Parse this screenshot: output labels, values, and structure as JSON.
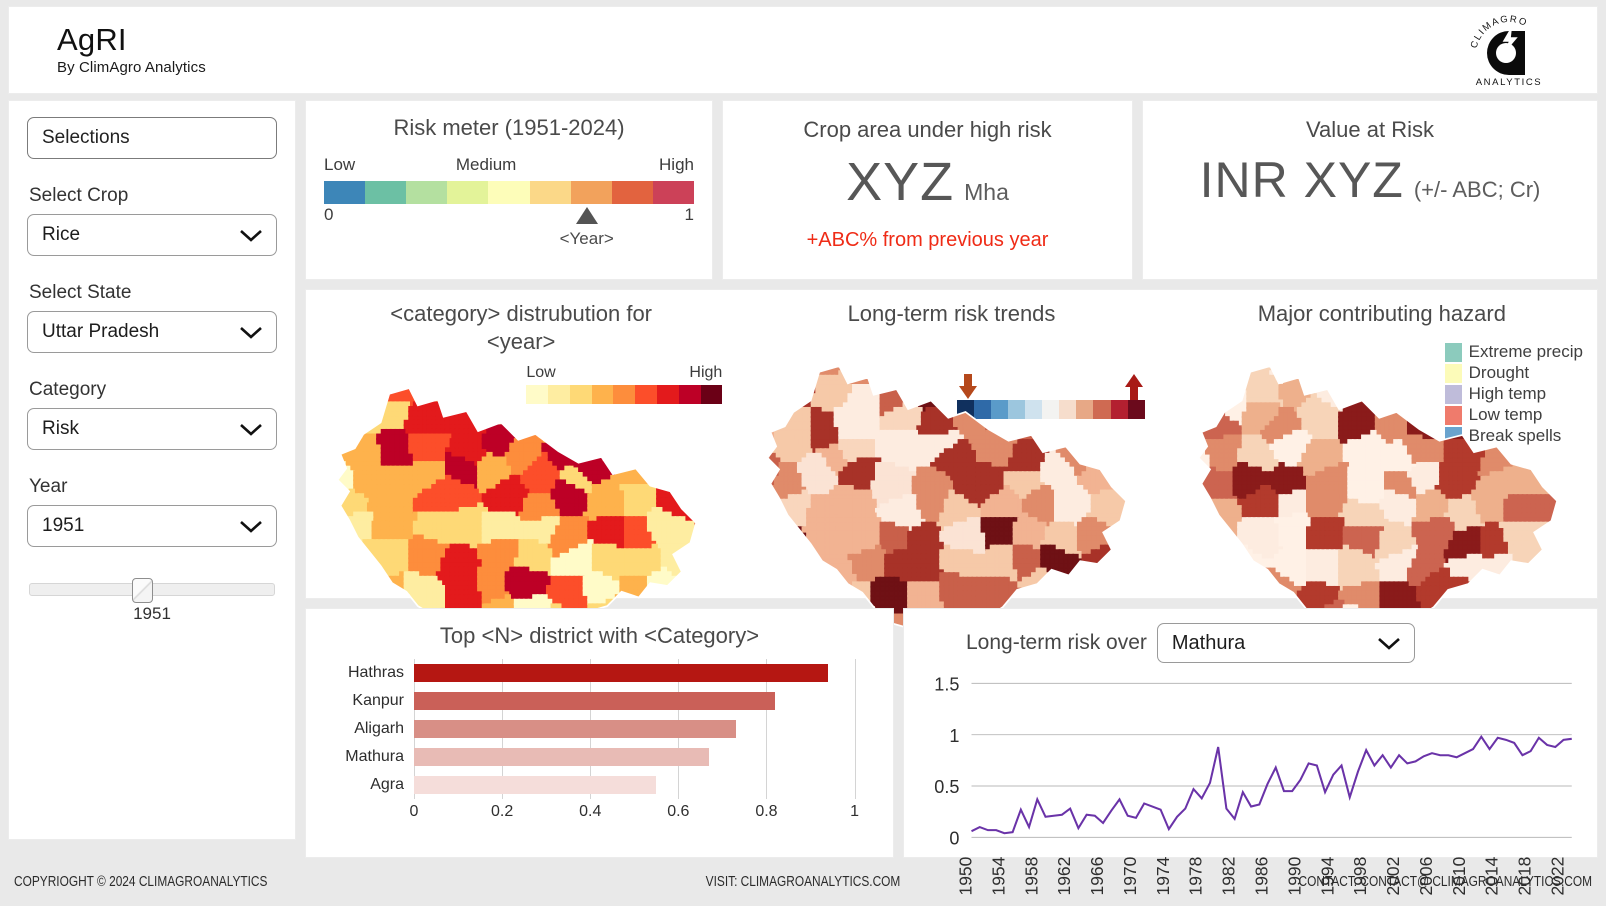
{
  "header": {
    "title": "AgRI",
    "subtitle": "By ClimAgro Analytics",
    "logo_top": "CLIMAGRO",
    "logo_bottom": "ANALYTICS"
  },
  "sidebar": {
    "panel_label": "Selections",
    "fields": [
      {
        "label": "Select Crop",
        "value": "Rice"
      },
      {
        "label": "Select State",
        "value": "Uttar Pradesh"
      },
      {
        "label": "Category",
        "value": "Risk"
      },
      {
        "label": "Year",
        "value": "1951"
      }
    ],
    "slider": {
      "value": "1951",
      "position_pct": 42
    }
  },
  "kpi": {
    "meter": {
      "title": "Risk meter (1951-2024)",
      "label_low": "Low",
      "label_medium": "Medium",
      "label_high": "High",
      "min": "0",
      "max": "1",
      "pointer_label": "<Year>",
      "pointer_pct": 71,
      "colors": [
        "#3d86b8",
        "#6cc0a4",
        "#b4e0a0",
        "#e3f399",
        "#fdfdb9",
        "#fbd888",
        "#f2a25c",
        "#e2633f",
        "#cc4158"
      ]
    },
    "crop_area": {
      "title": "Crop area under high risk",
      "value": "XYZ",
      "unit": "Mha",
      "delta": "+ABC% from previous year",
      "delta_color": "#ef2b16"
    },
    "value_at_risk": {
      "title": "Value at Risk",
      "value": "INR XYZ",
      "unit": "(+/- ABC; Cr)"
    }
  },
  "maps": {
    "distribution": {
      "title_line1": "<category> distrubution for",
      "title_line2": "<year>",
      "cbar_low": "Low",
      "cbar_high": "High",
      "colors": [
        "#fffbc8",
        "#feeda1",
        "#fed976",
        "#feb24c",
        "#fd8d3c",
        "#fc4e2a",
        "#e31a1c",
        "#bd0026",
        "#6b0016"
      ]
    },
    "trends": {
      "title": "Long-term risk trends",
      "colors": [
        "#10305e",
        "#2f6aa8",
        "#5a9bc9",
        "#9cc6de",
        "#cfe2ee",
        "#f3f3f1",
        "#f6ddcc",
        "#e7a886",
        "#cf6a52",
        "#b32030",
        "#6b0a1c"
      ],
      "down_arrow_color": "#b5481b",
      "up_arrow_color": "#a81a16"
    },
    "hazard": {
      "title": "Major contributing hazard",
      "legend": [
        {
          "label": "Extreme precip",
          "color": "#8ccbbd"
        },
        {
          "label": "Drought",
          "color": "#fcfbb9"
        },
        {
          "label": "High temp",
          "color": "#bfbcda"
        },
        {
          "label": "Low temp",
          "color": "#ef7b6c"
        },
        {
          "label": "Break spells",
          "color": "#6aa3ce"
        }
      ]
    }
  },
  "bar_panel": {
    "title": "Top <N> district with <Category>"
  },
  "line_panel": {
    "label": "Long-term risk over",
    "district": "Mathura"
  },
  "footer": {
    "copyright": "COPYRIOGHT © 2024 CLIMAGROANALYTICS",
    "visit": "VISIT: CLIMAGROANALYTICS.COM",
    "contact": "CONTACT: CONTACT@ CLIMAGROANALYTICS.COM"
  },
  "chart_data": [
    {
      "type": "bar",
      "title": "Top <N> district with <Category>",
      "orientation": "horizontal",
      "categories": [
        "Hathras",
        "Kanpur",
        "Aligarh",
        "Mathura",
        "Agra"
      ],
      "values": [
        0.94,
        0.82,
        0.73,
        0.67,
        0.55
      ],
      "bar_colors": [
        "#b51712",
        "#ca6058",
        "#d88f86",
        "#e8bbb5",
        "#f5ddda"
      ],
      "xlabel": "",
      "ylabel": "",
      "xlim": [
        0,
        1.06
      ],
      "xticks": [
        0,
        0.2,
        0.4,
        0.6,
        0.8,
        1
      ],
      "xticklabels": [
        "0",
        "0.2",
        "0.4",
        "0.6",
        "0.8",
        "1"
      ],
      "grid": "vertical"
    },
    {
      "type": "line",
      "title": "Long-term risk over Mathura",
      "series_name": "Risk",
      "line_color": "#6a33a8",
      "xlabel": "",
      "ylabel": "",
      "ylim": [
        0,
        1.55
      ],
      "yticks": [
        0,
        0.5,
        1,
        1.5
      ],
      "yticklabels": [
        "0",
        "0.5",
        "1",
        "1.5"
      ],
      "xticks": [
        1950,
        1954,
        1958,
        1962,
        1966,
        1970,
        1974,
        1978,
        1982,
        1986,
        1990,
        1994,
        1998,
        2002,
        2006,
        2010,
        2014,
        2018,
        2022
      ],
      "grid": "horizontal",
      "x": [
        1950,
        1951,
        1952,
        1953,
        1954,
        1955,
        1956,
        1957,
        1958,
        1959,
        1960,
        1961,
        1962,
        1963,
        1964,
        1965,
        1966,
        1967,
        1968,
        1969,
        1970,
        1971,
        1972,
        1973,
        1974,
        1975,
        1976,
        1977,
        1978,
        1979,
        1980,
        1981,
        1982,
        1983,
        1984,
        1985,
        1986,
        1987,
        1988,
        1989,
        1990,
        1991,
        1992,
        1993,
        1994,
        1995,
        1996,
        1997,
        1998,
        1999,
        2000,
        2001,
        2002,
        2003,
        2004,
        2005,
        2006,
        2007,
        2008,
        2009,
        2010,
        2011,
        2012,
        2013,
        2014,
        2015,
        2016,
        2017,
        2018,
        2019,
        2020,
        2021,
        2022,
        2023
      ],
      "y": [
        0.06,
        0.1,
        0.07,
        0.07,
        0.04,
        0.05,
        0.27,
        0.1,
        0.37,
        0.2,
        0.21,
        0.22,
        0.28,
        0.09,
        0.22,
        0.21,
        0.14,
        0.26,
        0.37,
        0.21,
        0.19,
        0.33,
        0.3,
        0.27,
        0.08,
        0.2,
        0.28,
        0.47,
        0.38,
        0.53,
        0.88,
        0.28,
        0.18,
        0.44,
        0.3,
        0.32,
        0.52,
        0.68,
        0.45,
        0.45,
        0.56,
        0.72,
        0.7,
        0.44,
        0.61,
        0.7,
        0.39,
        0.64,
        0.85,
        0.7,
        0.8,
        0.68,
        0.8,
        0.72,
        0.74,
        0.79,
        0.82,
        0.8,
        0.8,
        0.78,
        0.82,
        0.86,
        0.98,
        0.86,
        0.97,
        0.95,
        0.92,
        0.8,
        0.84,
        0.97,
        0.9,
        0.88,
        0.95,
        0.96
      ]
    }
  ]
}
